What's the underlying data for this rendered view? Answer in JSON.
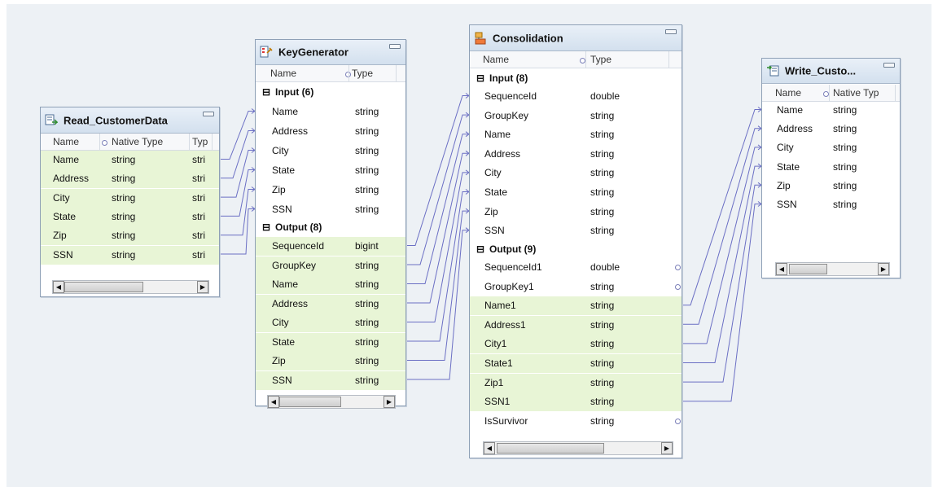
{
  "transformations": {
    "read": {
      "title": "Read_CustomerData",
      "icon": "read-source-icon",
      "columns": [
        "Name",
        "Native Type",
        "Typ"
      ],
      "rows": [
        [
          "Name",
          "string",
          "stri"
        ],
        [
          "Address",
          "string",
          "stri"
        ],
        [
          "City",
          "string",
          "stri"
        ],
        [
          "State",
          "string",
          "stri"
        ],
        [
          "Zip",
          "string",
          "stri"
        ],
        [
          "SSN",
          "string",
          "stri"
        ]
      ]
    },
    "keygen": {
      "title": "KeyGenerator",
      "icon": "key-generator-icon",
      "columns": [
        "Name",
        "Type"
      ],
      "input_group": "Input (6)",
      "inputs": [
        [
          "Name",
          "string"
        ],
        [
          "Address",
          "string"
        ],
        [
          "City",
          "string"
        ],
        [
          "State",
          "string"
        ],
        [
          "Zip",
          "string"
        ],
        [
          "SSN",
          "string"
        ]
      ],
      "output_group": "Output (8)",
      "outputs": [
        [
          "SequenceId",
          "bigint"
        ],
        [
          "GroupKey",
          "string"
        ],
        [
          "Name",
          "string"
        ],
        [
          "Address",
          "string"
        ],
        [
          "City",
          "string"
        ],
        [
          "State",
          "string"
        ],
        [
          "Zip",
          "string"
        ],
        [
          "SSN",
          "string"
        ]
      ]
    },
    "consolidation": {
      "title": "Consolidation",
      "icon": "consolidation-icon",
      "columns": [
        "Name",
        "Type"
      ],
      "input_group": "Input (8)",
      "inputs": [
        [
          "SequenceId",
          "double"
        ],
        [
          "GroupKey",
          "string"
        ],
        [
          "Name",
          "string"
        ],
        [
          "Address",
          "string"
        ],
        [
          "City",
          "string"
        ],
        [
          "State",
          "string"
        ],
        [
          "Zip",
          "string"
        ],
        [
          "SSN",
          "string"
        ]
      ],
      "output_group": "Output (9)",
      "outputs": [
        [
          "SequenceId1",
          "double"
        ],
        [
          "GroupKey1",
          "string"
        ],
        [
          "Name1",
          "string"
        ],
        [
          "Address1",
          "string"
        ],
        [
          "City1",
          "string"
        ],
        [
          "State1",
          "string"
        ],
        [
          "Zip1",
          "string"
        ],
        [
          "SSN1",
          "string"
        ],
        [
          "IsSurvivor",
          "string"
        ]
      ]
    },
    "write": {
      "title": "Write_Custo...",
      "icon": "write-target-icon",
      "columns": [
        "Name",
        "Native Typ"
      ],
      "rows": [
        [
          "Name",
          "string"
        ],
        [
          "Address",
          "string"
        ],
        [
          "City",
          "string"
        ],
        [
          "State",
          "string"
        ],
        [
          "Zip",
          "string"
        ],
        [
          "SSN",
          "string"
        ]
      ]
    }
  },
  "symbols": {
    "collapse": "⊟",
    "scroll_left": "◀",
    "scroll_right": "▶"
  },
  "colors": {
    "link": "#6b6fc4",
    "highlight_row": "#e8f5d6",
    "header": "#d3e0ee",
    "canvas": "#edf1f5"
  }
}
